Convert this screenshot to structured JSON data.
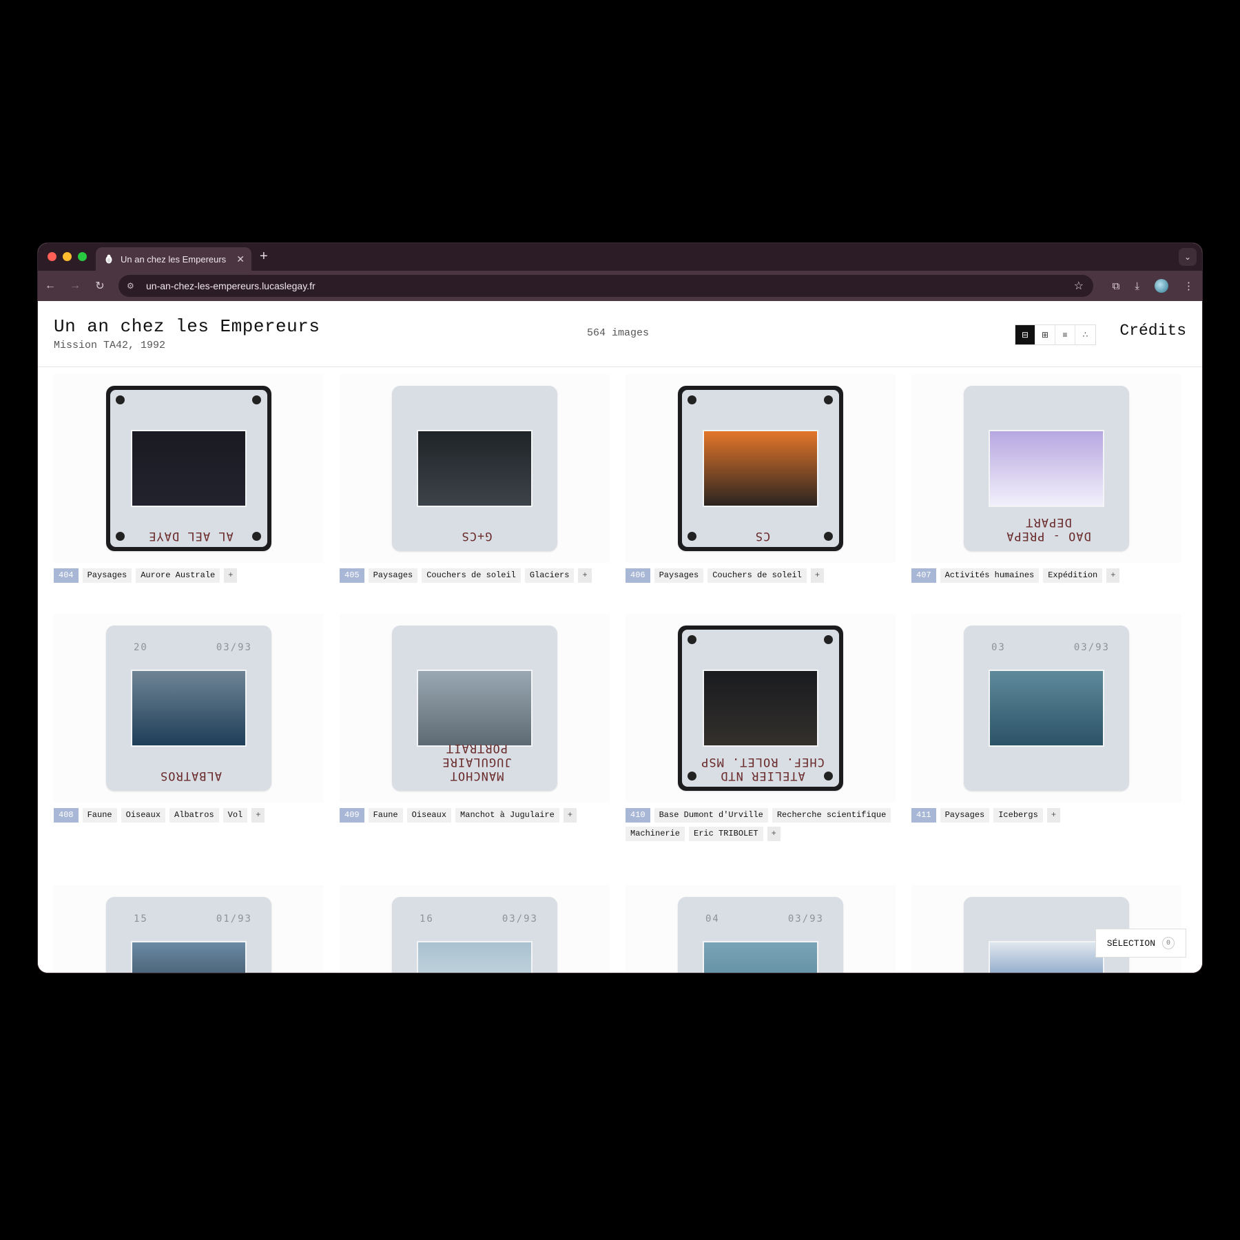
{
  "browser": {
    "tab_title": "Un an chez les Empereurs",
    "url": "un-an-chez-les-empereurs.lucaslegay.fr"
  },
  "header": {
    "title": "Un an chez les Empereurs",
    "subtitle": "Mission TA42, 1992",
    "count": "564 images",
    "credits": "Crédits",
    "view_icons": [
      "⊟",
      "⊞",
      "≡",
      "∴"
    ]
  },
  "cards": [
    {
      "num": "404",
      "tags": [
        "Paysages",
        "Aurore Australe"
      ],
      "scribble": "AL AEL DAYE",
      "stamp": [
        "",
        ""
      ],
      "frame": "black",
      "photo_colors": [
        "#1a1a22",
        "#22232e"
      ]
    },
    {
      "num": "405",
      "tags": [
        "Paysages",
        "Couchers de soleil",
        "Glaciers"
      ],
      "scribble": "G+CS",
      "stamp": [
        "",
        ""
      ],
      "frame": "grey",
      "photo_colors": [
        "#1f2428",
        "#3c4348"
      ]
    },
    {
      "num": "406",
      "tags": [
        "Paysages",
        "Couchers de soleil"
      ],
      "scribble": "CS",
      "stamp": [
        "",
        ""
      ],
      "frame": "black",
      "photo_colors": [
        "#e3762a",
        "#2b2420"
      ]
    },
    {
      "num": "407",
      "tags": [
        "Activités humaines",
        "Expédition"
      ],
      "scribble": "DAO - PREPA DEPART",
      "stamp": [
        "",
        ""
      ],
      "frame": "grey",
      "photo_colors": [
        "#b7a7e0",
        "#f2f0fb"
      ]
    },
    {
      "num": "408",
      "tags": [
        "Faune",
        "Oiseaux",
        "Albatros",
        "Vol"
      ],
      "scribble": "ALBATROS",
      "stamp": [
        "20",
        "03/93"
      ],
      "frame": "grey",
      "photo_colors": [
        "#6f8596",
        "#1f3e58"
      ]
    },
    {
      "num": "409",
      "tags": [
        "Faune",
        "Oiseaux",
        "Manchot à Jugulaire"
      ],
      "scribble": "MANCHOT JUGULAIRE PORTRAIT",
      "stamp": [
        "",
        ""
      ],
      "frame": "grey",
      "photo_colors": [
        "#9aa8b3",
        "#5e6a73"
      ]
    },
    {
      "num": "410",
      "tags": [
        "Base Dumont d'Urville",
        "Recherche scientifique",
        "Machinerie",
        "Eric TRIBOLET"
      ],
      "scribble": "ATELIER NTD CHEF. ROLET. MSP",
      "stamp": [
        "",
        ""
      ],
      "frame": "black",
      "photo_colors": [
        "#1a1b20",
        "#33302c"
      ]
    },
    {
      "num": "411",
      "tags": [
        "Paysages",
        "Icebergs"
      ],
      "scribble": "",
      "stamp": [
        "03",
        "03/93"
      ],
      "frame": "grey",
      "photo_colors": [
        "#5f8a9c",
        "#2c5266"
      ]
    },
    {
      "num": "",
      "tags": [],
      "scribble": "",
      "stamp": [
        "15",
        "01/93"
      ],
      "frame": "grey",
      "photo_colors": [
        "#6b8aa4",
        "#22313e"
      ]
    },
    {
      "num": "",
      "tags": [],
      "scribble": "",
      "stamp": [
        "16",
        "03/93"
      ],
      "frame": "grey",
      "photo_colors": [
        "#a9c2cf",
        "#d9e4ea"
      ]
    },
    {
      "num": "",
      "tags": [],
      "scribble": "",
      "stamp": [
        "04",
        "03/93"
      ],
      "frame": "grey",
      "photo_colors": [
        "#7aa4b6",
        "#4b7b8f"
      ]
    },
    {
      "num": "",
      "tags": [],
      "scribble": "",
      "stamp": [
        "",
        ""
      ],
      "frame": "grey",
      "photo_colors": [
        "#dfe7ee",
        "#2e5f9e"
      ]
    }
  ],
  "plus_label": "+",
  "selection": {
    "label": "SÉLECTION",
    "count": "0"
  }
}
